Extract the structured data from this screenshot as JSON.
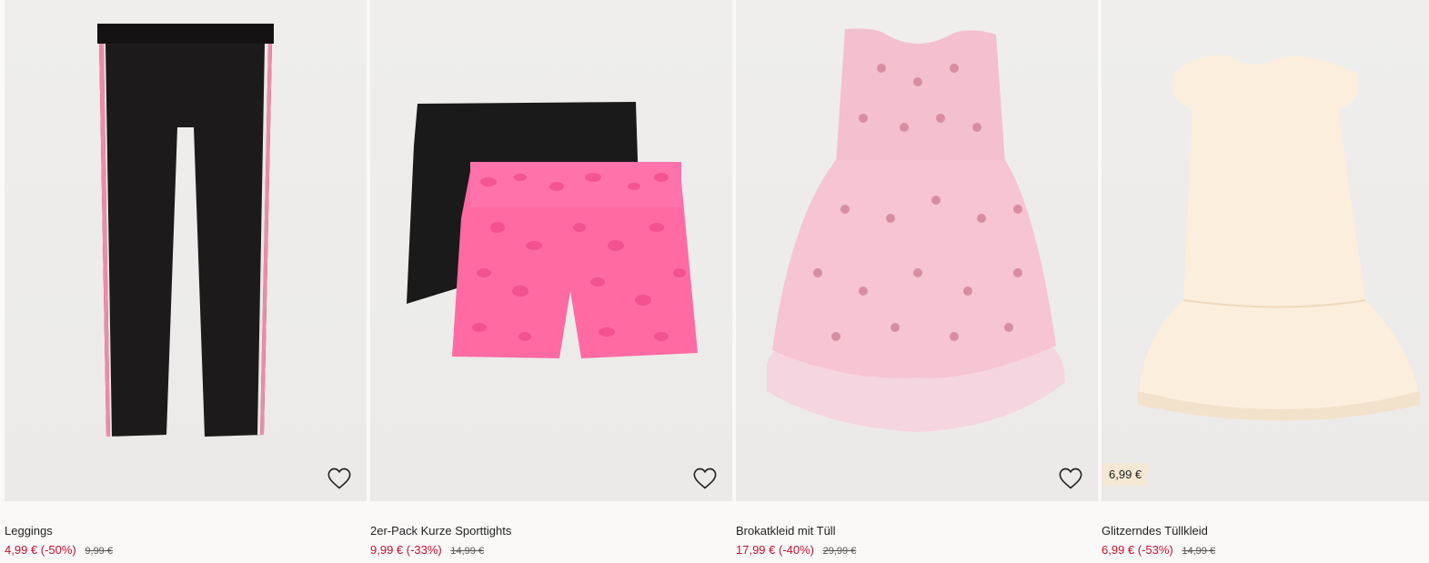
{
  "products": [
    {
      "title": "Leggings",
      "price": "4,99 € (-50%)",
      "old_price": "9,99 €",
      "icon": "heart-outline-icon"
    },
    {
      "title": "2er-Pack Kurze Sporttights",
      "price": "9,99 € (-33%)",
      "old_price": "14,99 €",
      "icon": "heart-outline-icon"
    },
    {
      "title": "Brokatkleid mit Tüll",
      "price": "17,99 € (-40%)",
      "old_price": "29,99 €",
      "icon": "heart-outline-icon"
    },
    {
      "title": "Glitzerndes Tüllkleid",
      "price": "6,99 € (-53%)",
      "old_price": "14,99 €",
      "badge": "6,99 €"
    }
  ],
  "colors": {
    "sale_red": "#c8102e",
    "badge_bg": "#f5e9d5",
    "background": "#faf9f8"
  }
}
